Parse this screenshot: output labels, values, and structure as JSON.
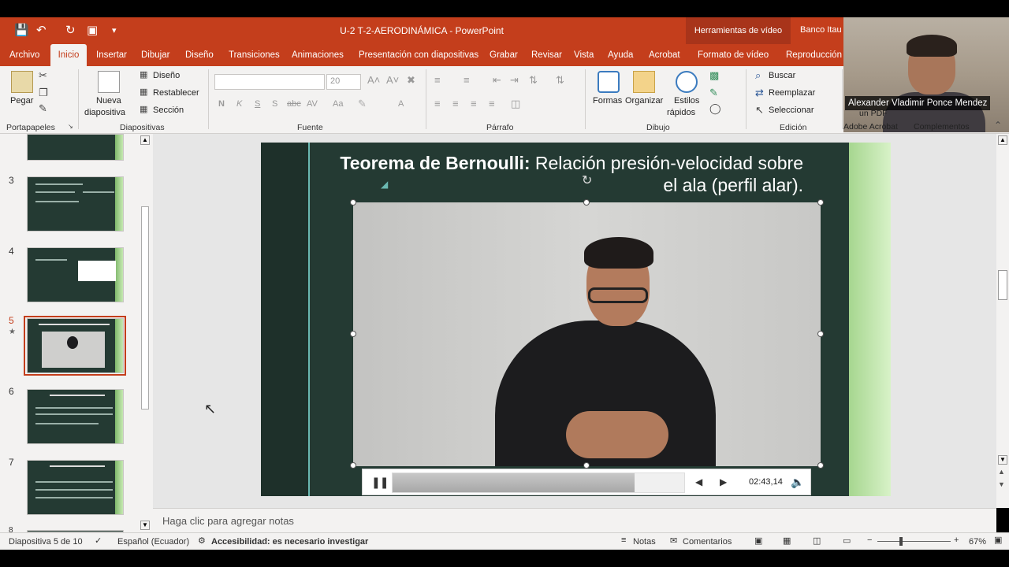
{
  "titlebar": {
    "title": "U-2 T-2-AERODINÁMICA  -  PowerPoint",
    "video_tools": "Herramientas de vídeo",
    "account": "Banco Itau"
  },
  "tabs": [
    "Archivo",
    "Inicio",
    "Insertar",
    "Dibujar",
    "Diseño",
    "Transiciones",
    "Animaciones",
    "Presentación con diapositivas",
    "Grabar",
    "Revisar",
    "Vista",
    "Ayuda",
    "Acrobat",
    "Formato de vídeo",
    "Reproducción"
  ],
  "ribbon": {
    "paste": "Pegar",
    "new_slide_1": "Nueva",
    "new_slide_2": "diapositiva",
    "layout": "Diseño",
    "reset": "Restablecer",
    "section": "Sección",
    "font_size": "20",
    "shapes": "Formas",
    "arrange": "Organizar",
    "quick_styles_1": "Estilos",
    "quick_styles_2": "rápidos",
    "find": "Buscar",
    "replace": "Reemplazar",
    "select": "Seleccionar",
    "groups": {
      "clipboard": "Portapapeles",
      "slides": "Diapositivas",
      "font": "Fuente",
      "paragraph": "Párrafo",
      "drawing": "Dibujo",
      "editing": "Edición",
      "acrobat": "Adobe Acrobat",
      "addins": "Complementos"
    },
    "font_buttons": [
      "N",
      "K",
      "S",
      "S",
      "abc",
      "AV",
      "Aa",
      "A"
    ]
  },
  "webcam": {
    "name": "Alexander Vladimir Ponce Mendez",
    "pdf_label": "un PDF"
  },
  "thumbnails": [
    {
      "num": "",
      "selected": false
    },
    {
      "num": "3",
      "selected": false
    },
    {
      "num": "4",
      "selected": false
    },
    {
      "num": "5",
      "selected": true,
      "star": "★"
    },
    {
      "num": "6",
      "selected": false
    },
    {
      "num": "7",
      "selected": false
    },
    {
      "num": "8",
      "selected": false
    }
  ],
  "slide": {
    "title_bold": "Teorema de Bernoulli:",
    "title_rest": " Relación presión-velocidad sobre el ala (perfil alar)."
  },
  "video": {
    "progress": 0.83,
    "time": "02:43,14"
  },
  "notes": {
    "placeholder": "Haga clic para agregar notas"
  },
  "status": {
    "slide_info": "Diapositiva 5 de 10",
    "language": "Español (Ecuador)",
    "accessibility": "Accesibilidad: es necesario investigar",
    "notes": "Notas",
    "comments": "Comentarios",
    "zoom": "67%"
  }
}
